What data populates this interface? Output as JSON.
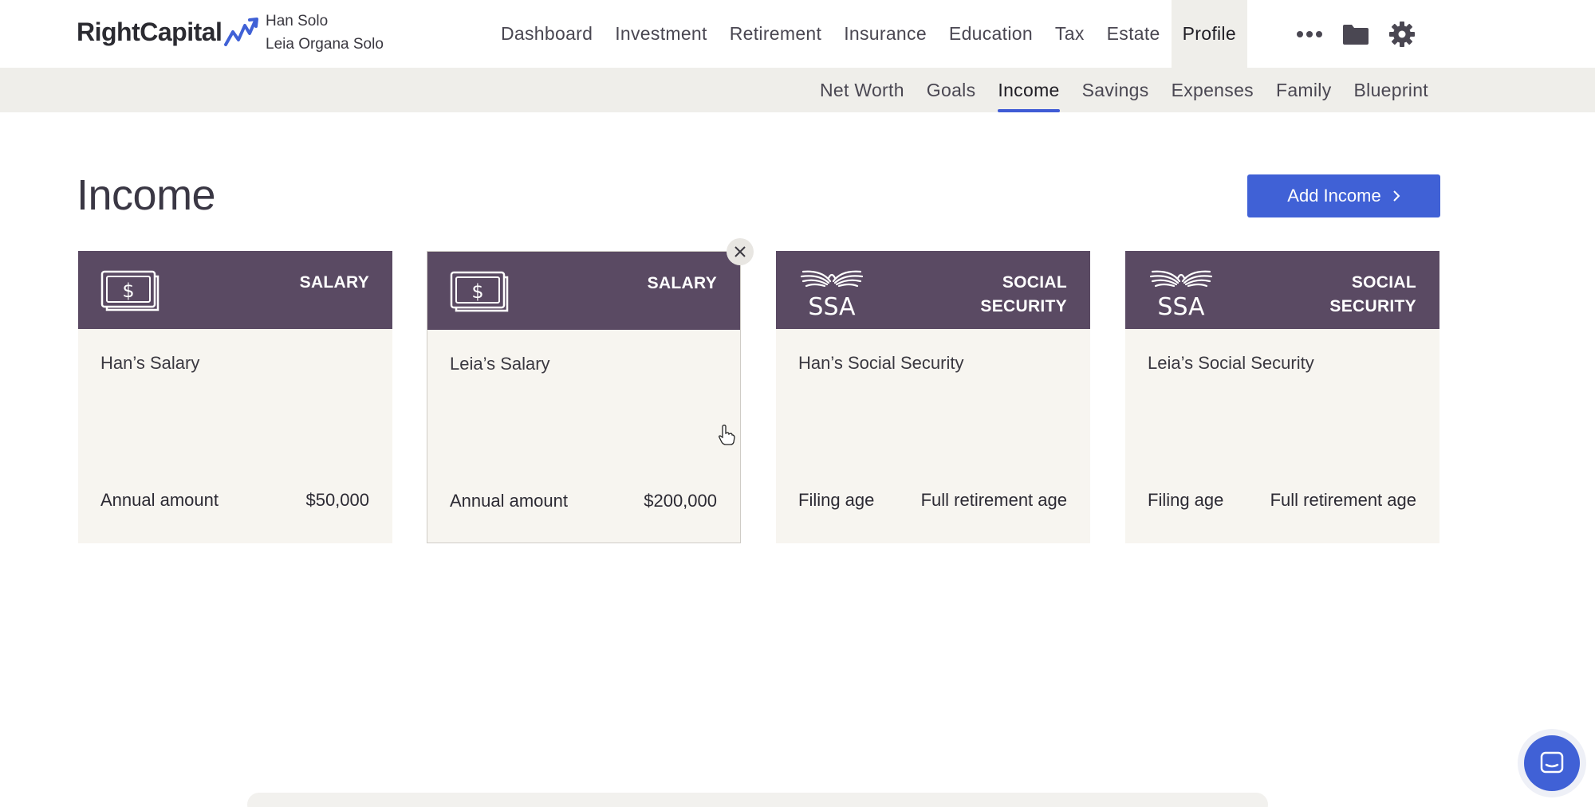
{
  "app": {
    "brand": "RightCapital"
  },
  "clients": {
    "primary": "Han Solo",
    "spouse": "Leia Organa Solo"
  },
  "main_nav": [
    {
      "label": "Dashboard"
    },
    {
      "label": "Investment"
    },
    {
      "label": "Retirement"
    },
    {
      "label": "Insurance"
    },
    {
      "label": "Education"
    },
    {
      "label": "Tax"
    },
    {
      "label": "Estate"
    },
    {
      "label": "Profile",
      "active": true
    }
  ],
  "nav_icons": [
    "more-icon",
    "folder-icon",
    "gear-icon"
  ],
  "sub_nav": [
    {
      "label": "Net Worth"
    },
    {
      "label": "Goals"
    },
    {
      "label": "Income",
      "active": true
    },
    {
      "label": "Savings"
    },
    {
      "label": "Expenses"
    },
    {
      "label": "Family"
    },
    {
      "label": "Blueprint"
    }
  ],
  "page": {
    "title": "Income",
    "add_button": "Add Income"
  },
  "cards": [
    {
      "type": "SALARY",
      "icon": "dollar-bill-icon",
      "name": "Han’s Salary",
      "left": "Annual amount",
      "right": "$50,000"
    },
    {
      "type": "SALARY",
      "icon": "dollar-bill-icon",
      "name": "Leia’s Salary",
      "left": "Annual amount",
      "right": "$200,000"
    },
    {
      "type": "SOCIAL\nSECURITY",
      "icon": "ssa-logo-icon",
      "name": "Han’s Social Security",
      "left": "Filing age",
      "right": "Full retirement age"
    },
    {
      "type": "SOCIAL\nSECURITY",
      "icon": "ssa-logo-icon",
      "name": "Leia’s Social Security",
      "left": "Filing age",
      "right": "Full retirement age"
    }
  ],
  "colors": {
    "accent": "#4061d6",
    "card_header": "#5a4a63",
    "card_body": "#f7f5f0",
    "subnav_bg": "#efeeea"
  }
}
